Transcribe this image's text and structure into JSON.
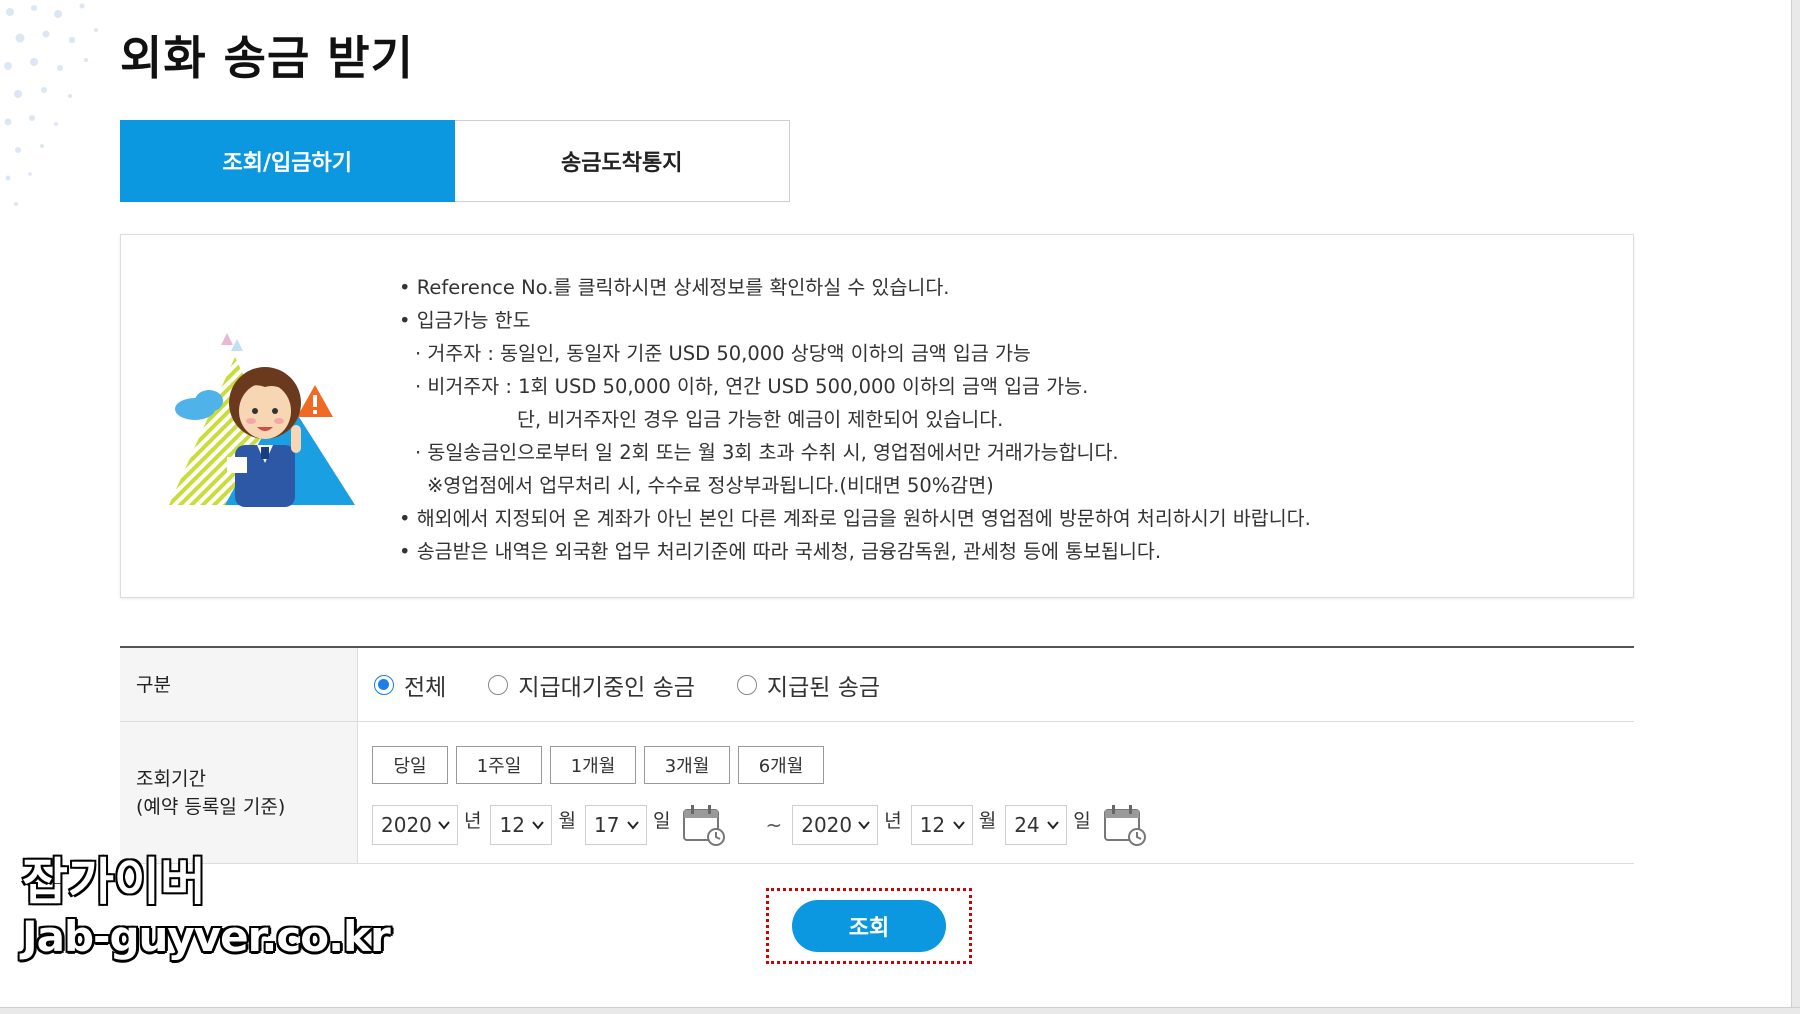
{
  "page": {
    "title": "외화 송금 받기"
  },
  "tabs": [
    {
      "label": "조회/입금하기",
      "active": true
    },
    {
      "label": "송금도착통지",
      "active": false
    }
  ],
  "notice": {
    "lines": [
      "• Reference No.를 클릭하시면 상세정보를 확인하실 수 있습니다.",
      "• 입금가능 한도",
      "· 거주자 : 동일인, 동일자 기준 USD 50,000 상당액 이하의 금액 입금 가능",
      "· 비거주자 : 1회 USD 50,000 이하, 연간 USD 500,000 이하의 금액 입금 가능.",
      "단, 비거주자인 경우 입금 가능한 예금이 제한되어 있습니다.",
      "· 동일송금인으로부터 일 2회 또는 월 3회 초과 수취 시, 영업점에서만 거래가능합니다.",
      "※영업점에서 업무처리 시, 수수료 정상부과됩니다.(비대면 50%감면)",
      "• 해외에서 지정되어 온 계좌가 아닌 본인 다른 계좌로 입금을 원하시면 영업점에 방문하여 처리하시기 바랍니다.",
      "• 송금받은 내역은 외국환 업무 처리기준에 따라 국세청, 금융감독원, 관세청 등에 통보됩니다."
    ],
    "illustration_icon": "customer-service-agent-warning-illustration"
  },
  "filter": {
    "type_label": "구분",
    "type_options": [
      {
        "label": "전체",
        "checked": true
      },
      {
        "label": "지급대기중인 송금",
        "checked": false
      },
      {
        "label": "지급된 송금",
        "checked": false
      }
    ],
    "period_label_line1": "조회기간",
    "period_label_line2": "(예약 등록일 기준)",
    "period_buttons": [
      "당일",
      "1주일",
      "1개월",
      "3개월",
      "6개월"
    ],
    "from": {
      "year": "2020",
      "month": "12",
      "day": "17"
    },
    "to": {
      "year": "2020",
      "month": "12",
      "day": "24"
    },
    "unit_year": "년",
    "unit_month": "월",
    "unit_day": "일",
    "range_sep": "~"
  },
  "search_button": "조회",
  "watermark": {
    "line1": "잡가이버",
    "line2": "Jab-guyver.co.kr"
  },
  "colors": {
    "accent": "#0c98e0",
    "radio_checked": "#1a7fe8",
    "highlight_border": "#d40000"
  }
}
